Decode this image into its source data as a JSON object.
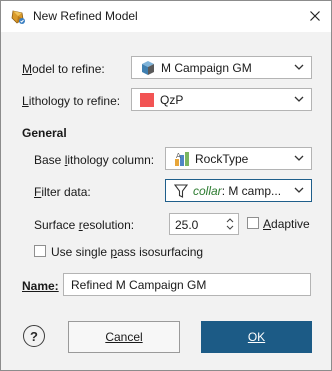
{
  "window": {
    "title": "New Refined Model"
  },
  "model_to_refine": {
    "label_prefix": "",
    "label_mnemonic": "M",
    "label_rest": "odel to refine:",
    "value": "M Campaign GM",
    "icon": "geological-model-icon"
  },
  "lithology_to_refine": {
    "label_prefix": "",
    "label_mnemonic": "L",
    "label_rest": "ithology to refine:",
    "value": "QzP",
    "swatch_color": "#f25454"
  },
  "general": {
    "title": "General",
    "base_lithology": {
      "label_prefix": "Base ",
      "label_mnemonic": "l",
      "label_rest": "ithology column:",
      "value": "RockType",
      "icon": "lithology-column-icon"
    },
    "filter_data": {
      "label_prefix": "",
      "label_mnemonic": "F",
      "label_rest": "ilter data:",
      "value_italic": "collar",
      "value_rest": ": M camp...",
      "icon": "filter-icon"
    },
    "surface_resolution": {
      "label_prefix": "Surface ",
      "label_mnemonic": "r",
      "label_rest": "esolution:",
      "value": "25.0"
    },
    "adaptive": {
      "label_prefix": "",
      "label_mnemonic": "A",
      "label_rest": "daptive",
      "checked": false
    },
    "single_pass": {
      "label_prefix": "Use single ",
      "label_mnemonic": "p",
      "label_rest": "ass isosurfacing",
      "checked": false
    }
  },
  "name": {
    "label": "Name:",
    "value": "Refined M Campaign GM"
  },
  "buttons": {
    "help": "?",
    "cancel": "Cancel",
    "ok": "OK"
  },
  "colors": {
    "accent": "#1c5b86",
    "window_bg": "#f2f2f2",
    "collar_green": "#2f7d32"
  }
}
